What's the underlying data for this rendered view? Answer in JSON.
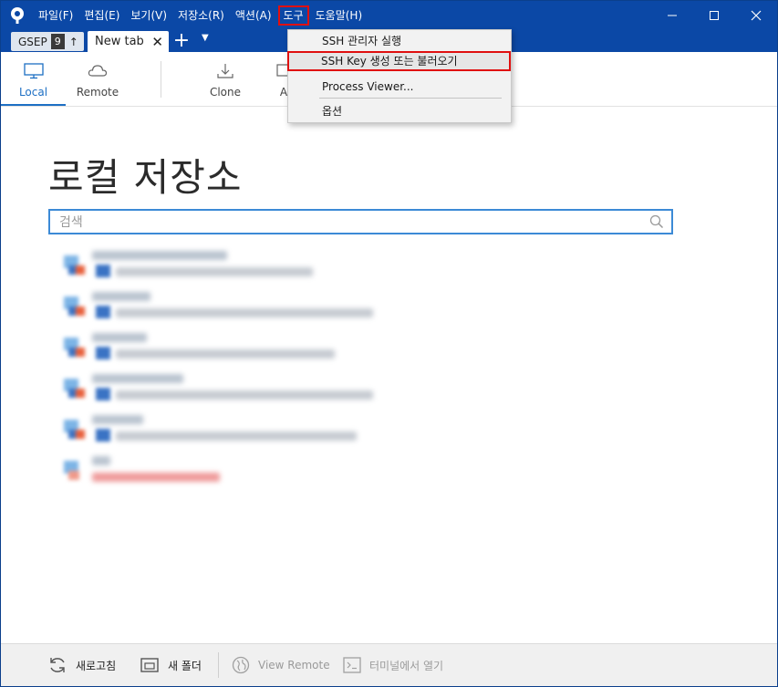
{
  "menu": {
    "items": [
      "파일(F)",
      "편집(E)",
      "보기(V)",
      "저장소(R)",
      "액션(A)",
      "도구",
      "도움말(H)"
    ],
    "active_index": 5
  },
  "tabs": {
    "repo_tab": {
      "label": "GSEP",
      "count": "9",
      "arrow": "↑"
    },
    "new_tab": {
      "label": "New tab"
    },
    "add_tab_symbol": "+"
  },
  "toolbar": {
    "local": "Local",
    "remote": "Remote",
    "clone": "Clone",
    "add": "A"
  },
  "main": {
    "title": "로컬 저장소",
    "search_placeholder": "검색"
  },
  "tools_menu": {
    "items": [
      {
        "label": "SSH 관리자 실행",
        "highlighted": false
      },
      {
        "label": "SSH Key 생성 또는 불러오기",
        "highlighted": true
      },
      {
        "label": "Process Viewer...",
        "highlighted": false
      },
      {
        "label": "옵션",
        "highlighted": false
      }
    ]
  },
  "statusbar": {
    "refresh": "새로고침",
    "new_folder": "새 폴더",
    "view_remote": "View Remote",
    "open_terminal": "터미널에서 열기"
  },
  "colors": {
    "titlebar": "#0b48a6",
    "accent": "#1d6fc4",
    "highlight_border": "#e01010"
  }
}
